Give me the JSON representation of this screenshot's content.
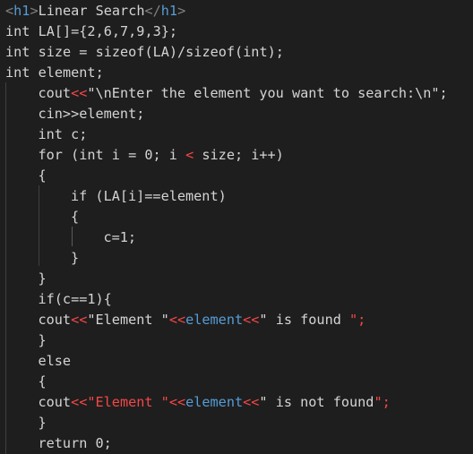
{
  "editor": {
    "lines": [
      {
        "indent": 0,
        "tokens": [
          {
            "text": "<",
            "color": "tag"
          },
          {
            "text": "h1",
            "color": "tagname"
          },
          {
            "text": ">",
            "color": "tag"
          },
          {
            "text": "Linear Search",
            "color": "default"
          },
          {
            "text": "</",
            "color": "tag"
          },
          {
            "text": "h1",
            "color": "tagname"
          },
          {
            "text": ">",
            "color": "tag"
          }
        ]
      },
      {
        "indent": 0,
        "tokens": [
          {
            "text": "int LA[]={2,6,7,9,3};",
            "color": "default"
          }
        ]
      },
      {
        "indent": 0,
        "tokens": [
          {
            "text": "int size = sizeof(LA)/sizeof(int);",
            "color": "default"
          }
        ]
      },
      {
        "indent": 0,
        "tokens": [
          {
            "text": "int element;",
            "color": "default"
          }
        ]
      },
      {
        "indent": 1,
        "tokens": [
          {
            "text": "cout",
            "color": "default"
          },
          {
            "text": "<<",
            "color": "red"
          },
          {
            "text": "\"\\nEnter the element you want to search:\\n\";",
            "color": "default"
          }
        ]
      },
      {
        "indent": 1,
        "tokens": [
          {
            "text": "cin>>element;",
            "color": "default"
          }
        ]
      },
      {
        "indent": 1,
        "tokens": [
          {
            "text": "int c;",
            "color": "default"
          }
        ]
      },
      {
        "indent": 1,
        "tokens": [
          {
            "text": "for (int i = 0; i ",
            "color": "default"
          },
          {
            "text": "<",
            "color": "red"
          },
          {
            "text": " size; i++)",
            "color": "default"
          }
        ]
      },
      {
        "indent": 1,
        "tokens": [
          {
            "text": "{",
            "color": "default"
          }
        ]
      },
      {
        "indent": 2,
        "tokens": [
          {
            "text": "if (LA[i]==element)",
            "color": "default"
          }
        ]
      },
      {
        "indent": 2,
        "tokens": [
          {
            "text": "{",
            "color": "default"
          }
        ]
      },
      {
        "indent": 3,
        "tokens": [
          {
            "text": "c=1;",
            "color": "default"
          }
        ]
      },
      {
        "indent": 2,
        "tokens": [
          {
            "text": "}",
            "color": "default"
          }
        ]
      },
      {
        "indent": 1,
        "tokens": [
          {
            "text": "}",
            "color": "default"
          }
        ]
      },
      {
        "indent": 1,
        "tokens": [
          {
            "text": "if(c==1){",
            "color": "default"
          }
        ]
      },
      {
        "indent": 1,
        "tokens": [
          {
            "text": "cout",
            "color": "default"
          },
          {
            "text": "<<",
            "color": "red"
          },
          {
            "text": "\"Element \"",
            "color": "default"
          },
          {
            "text": "<<",
            "color": "red"
          },
          {
            "text": "element",
            "color": "blue"
          },
          {
            "text": "<<",
            "color": "red"
          },
          {
            "text": "\" is found ",
            "color": "default"
          },
          {
            "text": "\";",
            "color": "red"
          }
        ]
      },
      {
        "indent": 1,
        "tokens": [
          {
            "text": "}",
            "color": "default"
          }
        ]
      },
      {
        "indent": 1,
        "tokens": [
          {
            "text": "else",
            "color": "default"
          }
        ]
      },
      {
        "indent": 1,
        "tokens": [
          {
            "text": "{",
            "color": "default"
          }
        ]
      },
      {
        "indent": 1,
        "tokens": [
          {
            "text": "cout",
            "color": "default"
          },
          {
            "text": "<<",
            "color": "red"
          },
          {
            "text": "\"Element \"",
            "color": "red"
          },
          {
            "text": "<<",
            "color": "red"
          },
          {
            "text": "element",
            "color": "blue"
          },
          {
            "text": "<<",
            "color": "red"
          },
          {
            "text": "\" is not found",
            "color": "default"
          },
          {
            "text": "\";",
            "color": "red"
          }
        ]
      },
      {
        "indent": 1,
        "tokens": [
          {
            "text": "}",
            "color": "default"
          }
        ]
      },
      {
        "indent": 1,
        "tokens": [
          {
            "text": "return 0;",
            "color": "default"
          }
        ]
      }
    ]
  },
  "theme": {
    "background": "#1e1e1e",
    "default": "#d4d4d4",
    "tag": "#808080",
    "tagname": "#569cd6",
    "red": "#f44747",
    "blue": "#569cd6"
  }
}
